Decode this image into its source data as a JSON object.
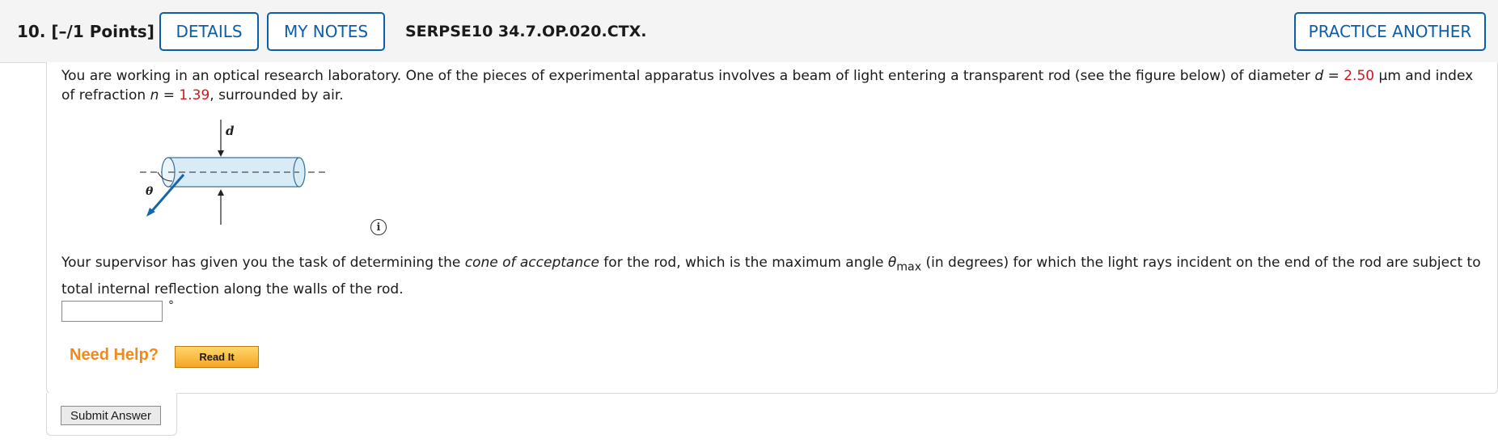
{
  "header": {
    "question_number": "10.",
    "points": "[–/1 Points]",
    "details_label": "DETAILS",
    "my_notes_label": "MY NOTES",
    "question_code": "SERPSE10 34.7.OP.020.CTX.",
    "practice_label": "PRACTICE ANOTHER"
  },
  "problem": {
    "p1_a": "You are working in an optical research laboratory. One of the pieces of experimental apparatus involves a beam of light entering a transparent rod (see the figure below) of diameter ",
    "d_symbol": "d",
    "eq": " = ",
    "d_value": "2.50",
    "p1_b": " μm and index of refraction ",
    "n_symbol": "n",
    "n_value": "1.39",
    "p1_c": ", surrounded by air.",
    "p2_a": "Your supervisor has given you the task of determining the ",
    "p2_italic": "cone of acceptance",
    "p2_b": " for the rod, which is the maximum angle ",
    "theta": "θ",
    "sub_max": "max",
    "p2_c": " (in degrees) for which the light rays incident on the end of the rod are subject to total internal reflection along the walls of the rod."
  },
  "figure": {
    "label_d": "d",
    "label_theta": "θ"
  },
  "info_icon": "i",
  "answer": {
    "value": "",
    "unit": "°"
  },
  "help": {
    "need_help": "Need Help?",
    "read_it": "Read It"
  },
  "submit_label": "Submit Answer",
  "colors": {
    "accent_blue": "#0b5eaa",
    "value_red": "#d2141a",
    "help_orange": "#f08a1c",
    "rod_fill": "#d7ecf7"
  }
}
